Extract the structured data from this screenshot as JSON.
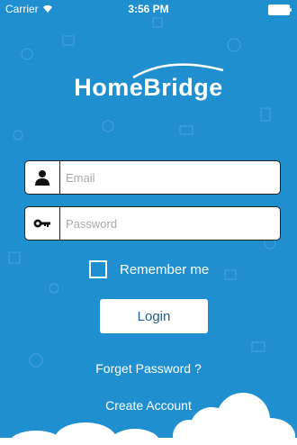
{
  "status_bar": {
    "carrier": "Carrier",
    "time": "3:56 PM"
  },
  "logo": {
    "text": "HomeBridge"
  },
  "email": {
    "placeholder": "Email"
  },
  "password": {
    "placeholder": "Password"
  },
  "remember": {
    "label": "Remember me"
  },
  "login": {
    "label": "Login"
  },
  "links": {
    "forgot": "Forget Password ?",
    "create": "Create Account"
  },
  "colors": {
    "background": "#1f8fd0",
    "button_text": "#1f5f8f"
  }
}
